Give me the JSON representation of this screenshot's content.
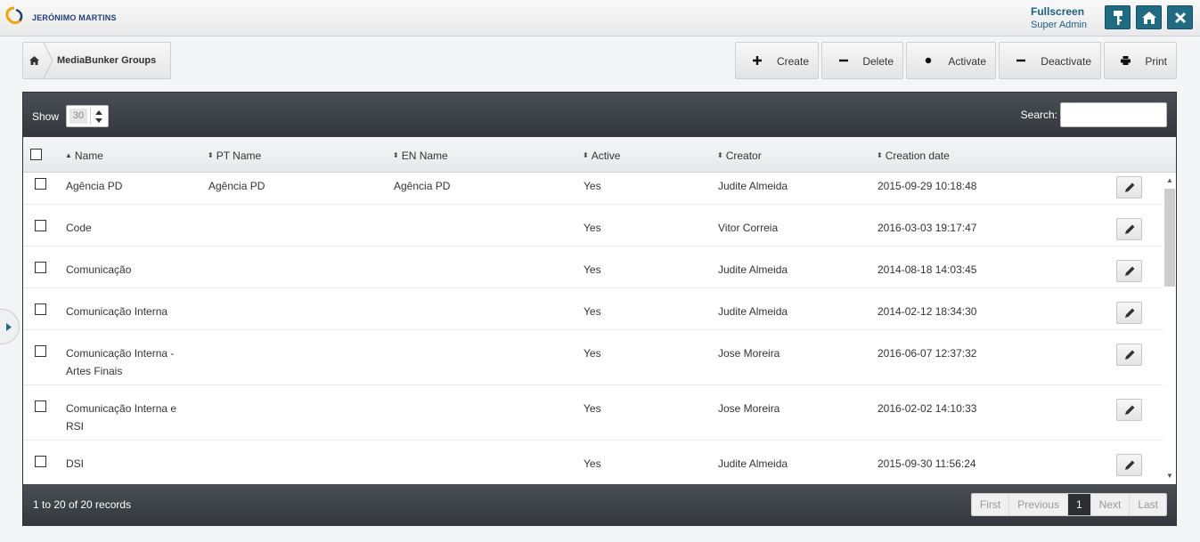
{
  "header": {
    "brand": "JERÓNIMO MARTINS",
    "fullscreen_label": "Fullscreen",
    "role": "Super Admin",
    "buttons": [
      {
        "name": "key-icon"
      },
      {
        "name": "home-icon"
      },
      {
        "name": "close-icon"
      }
    ]
  },
  "breadcrumb": {
    "home_icon": "home-icon",
    "label": "MediaBunker Groups"
  },
  "toolbar": {
    "create": {
      "label": "Create",
      "icon": "plus-icon"
    },
    "delete": {
      "label": "Delete",
      "icon": "minus-icon"
    },
    "activate": {
      "label": "Activate",
      "icon": "dot-icon"
    },
    "deactivate": {
      "label": "Deactivate",
      "icon": "minus-icon"
    },
    "print": {
      "label": "Print",
      "icon": "printer-icon"
    }
  },
  "table": {
    "show_label": "Show",
    "page_size": "30",
    "search_label": "Search:",
    "search_value": "",
    "columns": {
      "name": "Name",
      "pt_name": "PT Name",
      "en_name": "EN Name",
      "active": "Active",
      "creator": "Creator",
      "creation_date": "Creation date"
    },
    "sorted_column": "Name",
    "rows": [
      {
        "name": "Agência PD",
        "pt_name": "Agência PD",
        "en_name": "Agência PD",
        "active": "Yes",
        "creator": "Judite Almeida",
        "date": "2015-09-29 10:18:48"
      },
      {
        "name": "Code",
        "pt_name": "",
        "en_name": "",
        "active": "Yes",
        "creator": "Vitor Correia",
        "date": "2016-03-03 19:17:47"
      },
      {
        "name": "Comunicação",
        "pt_name": "",
        "en_name": "",
        "active": "Yes",
        "creator": "Judite Almeida",
        "date": "2014-08-18 14:03:45"
      },
      {
        "name": "Comunicação Interna",
        "pt_name": "",
        "en_name": "",
        "active": "Yes",
        "creator": "Judite Almeida",
        "date": "2014-02-12 18:34:30"
      },
      {
        "name": "Comunicação Interna - Artes Finais",
        "pt_name": "",
        "en_name": "",
        "active": "Yes",
        "creator": "Jose Moreira",
        "date": "2016-06-07 12:37:32"
      },
      {
        "name": "Comunicação Interna e RSI",
        "pt_name": "",
        "en_name": "",
        "active": "Yes",
        "creator": "Jose Moreira",
        "date": "2016-02-02 14:10:33"
      },
      {
        "name": "DSI",
        "pt_name": "",
        "en_name": "",
        "active": "Yes",
        "creator": "Judite Almeida",
        "date": "2015-09-30 11:56:24"
      }
    ],
    "records_info": "1 to 20 of 20 records",
    "pagination": {
      "first": "First",
      "previous": "Previous",
      "current": "1",
      "next": "Next",
      "last": "Last"
    }
  },
  "colors": {
    "accent": "#1f6b84",
    "panel_dark": "#3a3f44",
    "link_blue": "#1b5e86"
  }
}
